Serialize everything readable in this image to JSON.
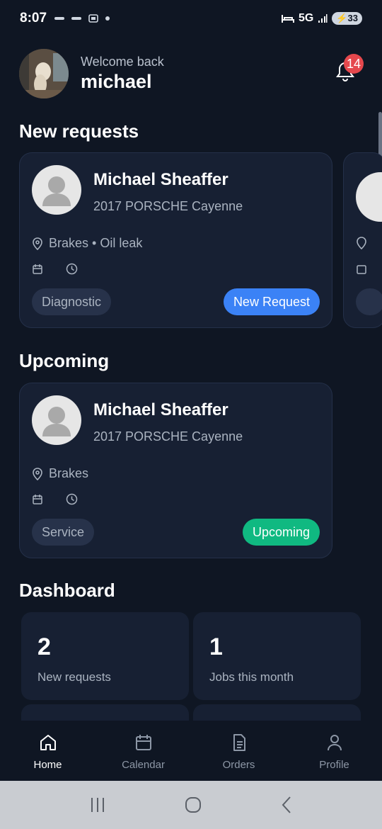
{
  "status_bar": {
    "time": "8:07",
    "network": "5G",
    "battery": "33"
  },
  "header": {
    "welcome": "Welcome back",
    "name": "michael",
    "notification_count": "14"
  },
  "sections": {
    "new_requests": "New requests",
    "upcoming": "Upcoming",
    "dashboard": "Dashboard"
  },
  "new_request_card": {
    "name": "Michael Sheaffer",
    "car": "2017 PORSCHE Cayenne",
    "issues": "Brakes • Oil leak",
    "chip": "Diagnostic",
    "status": "New Request",
    "status_color": "#3b82f6"
  },
  "upcoming_card": {
    "name": "Michael Sheaffer",
    "car": "2017 PORSCHE Cayenne",
    "issues": "Brakes",
    "chip": "Service",
    "status": "Upcoming",
    "status_color": "#10b981"
  },
  "dashboard": [
    {
      "value": "2",
      "label": "New requests"
    },
    {
      "value": "1",
      "label": "Jobs this month"
    }
  ],
  "bottom_nav": [
    {
      "label": "Home",
      "icon": "home-icon",
      "active": true
    },
    {
      "label": "Calendar",
      "icon": "calendar-icon",
      "active": false
    },
    {
      "label": "Orders",
      "icon": "document-icon",
      "active": false
    },
    {
      "label": "Profile",
      "icon": "person-icon",
      "active": false
    }
  ]
}
